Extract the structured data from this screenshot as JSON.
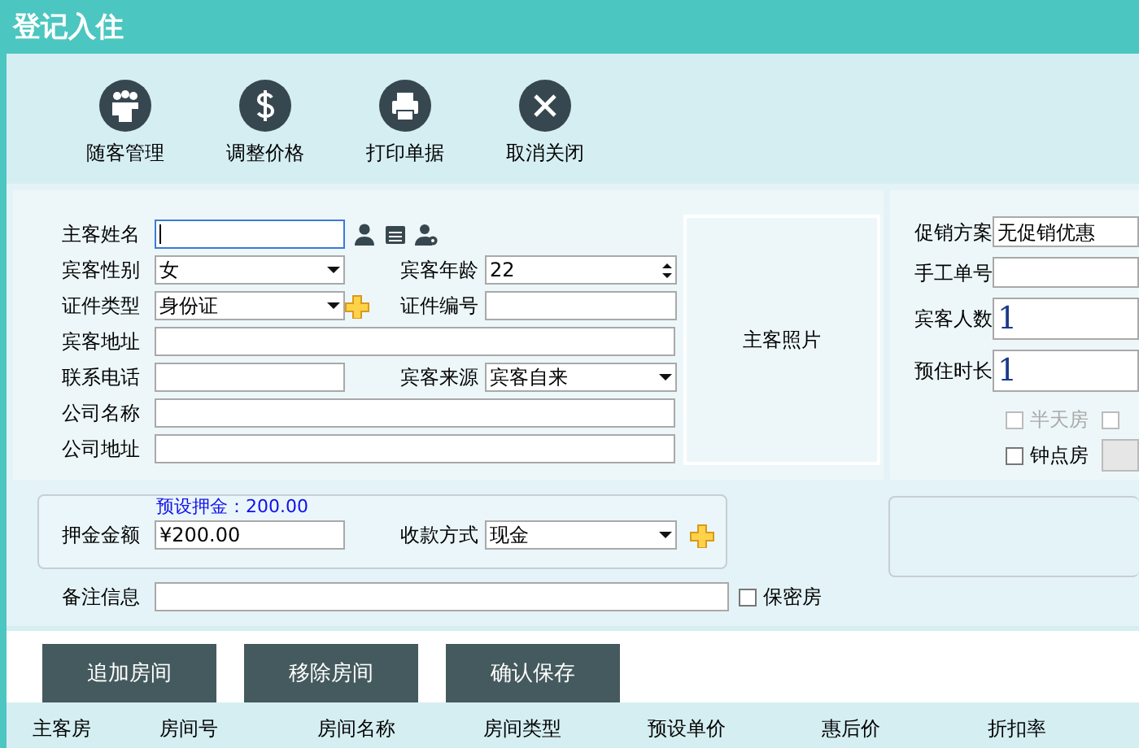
{
  "window": {
    "title": "登记入住"
  },
  "toolbar": [
    {
      "kind": "guests",
      "label": "随客管理"
    },
    {
      "kind": "price",
      "label": "调整价格"
    },
    {
      "kind": "print",
      "label": "打印单据"
    },
    {
      "kind": "close",
      "label": "取消关闭"
    }
  ],
  "guest_form": {
    "rows": [
      {
        "fields": [
          {
            "label": "主客姓名",
            "kind": "text",
            "focused": true,
            "icons": [
              {
                "kind": "user"
              },
              {
                "kind": "list"
              },
              {
                "kind": "user-settings"
              }
            ]
          }
        ]
      },
      {
        "fields": [
          {
            "label": "宾客性别",
            "kind": "select",
            "value": "女"
          },
          {
            "label": "宾客年龄",
            "kind": "spin",
            "value": "22"
          }
        ]
      },
      {
        "fields": [
          {
            "label": "证件类型",
            "kind": "select",
            "value": "身份证",
            "icons": [
              {
                "kind": "add"
              }
            ]
          },
          {
            "label": "证件编号",
            "kind": "text"
          }
        ]
      },
      {
        "fields": [
          {
            "label": "宾客地址",
            "kind": "text"
          }
        ]
      },
      {
        "fields": [
          {
            "label": "联系电话",
            "kind": "text"
          },
          {
            "label": "宾客来源",
            "kind": "select",
            "value": "宾客自来"
          }
        ]
      },
      {
        "fields": [
          {
            "label": "公司名称",
            "kind": "text"
          }
        ]
      },
      {
        "fields": [
          {
            "label": "公司地址",
            "kind": "text"
          }
        ]
      }
    ],
    "photo": {
      "label": "主客照片"
    }
  },
  "promo_panel": {
    "fields": [
      {
        "label": "促销方案",
        "kind": "text",
        "value": "无促销优惠"
      },
      {
        "label": "手工单号",
        "kind": "text"
      },
      {
        "label": "宾客人数",
        "kind": "large",
        "value": "1"
      },
      {
        "label": "预住时长",
        "kind": "large",
        "value": "1"
      }
    ],
    "checkbox_rows": [
      {
        "items": [
          {
            "label": "半天房",
            "checked": false,
            "disabled": true
          },
          {
            "checked": false,
            "disabled": true
          }
        ]
      },
      {
        "items": [
          {
            "label": "钟点房",
            "checked": false,
            "disabled": false
          }
        ],
        "button": true
      }
    ]
  },
  "deposit": {
    "hint": "预设押金：200.00",
    "amount": {
      "label": "押金金额",
      "value": "¥200.00"
    },
    "payment": {
      "label": "收款方式",
      "value": "现金"
    }
  },
  "remark": {
    "label": "备注信息",
    "confidential": {
      "label": "保密房",
      "checked": false
    }
  },
  "buttons": [
    "追加房间",
    "移除房间",
    "确认保存"
  ],
  "table": {
    "columns": [
      "主客房",
      "房间号",
      "房间名称",
      "房间类型",
      "预设单价",
      "惠后价",
      "折扣率"
    ]
  }
}
